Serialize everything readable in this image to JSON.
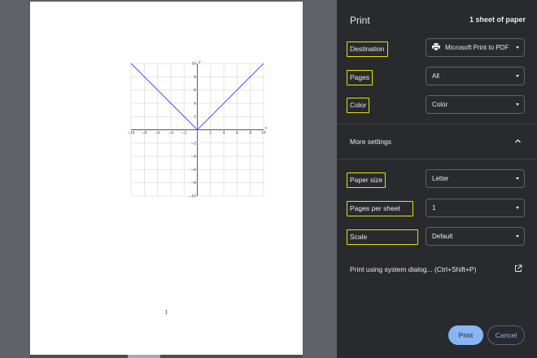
{
  "header": {
    "title": "Print",
    "sheet_count": "1 sheet of paper"
  },
  "settings": {
    "destination": {
      "label": "Destination",
      "value": "Microsoft Print to PDF",
      "icon": "printer-icon"
    },
    "pages": {
      "label": "Pages",
      "value": "All"
    },
    "color": {
      "label": "Color",
      "value": "Color"
    },
    "more_settings": "More settings",
    "paper_size": {
      "label": "Paper size",
      "value": "Letter"
    },
    "pages_per_sheet": {
      "label": "Pages per sheet",
      "value": "1"
    },
    "scale": {
      "label": "Scale",
      "value": "Default"
    }
  },
  "system_dialog": "Print using system dialog... (Ctrl+Shift+P)",
  "buttons": {
    "print": "Print",
    "cancel": "Cancel"
  },
  "highlight_color": "#e8e200",
  "preview": {
    "page_number": "1",
    "graph": {
      "x_ticks": [
        "−10",
        "−8",
        "−6",
        "−4",
        "−2",
        "2",
        "4",
        "6",
        "8",
        "10"
      ],
      "x_values": [
        -10,
        -8,
        -6,
        -4,
        -2,
        2,
        4,
        6,
        8,
        10
      ],
      "y_ticks": [
        "10",
        "8",
        "6",
        "4",
        "2",
        "−2",
        "−4",
        "−6",
        "−8",
        "−10"
      ],
      "y_values": [
        10,
        8,
        6,
        4,
        2,
        -2,
        -4,
        -6,
        -8,
        -10
      ],
      "x_axis_label": "x",
      "y_axis_label": "y",
      "xlim": [
        -10,
        10
      ],
      "ylim": [
        -10,
        10
      ],
      "line_points": [
        [
          -10,
          10
        ],
        [
          0,
          0
        ],
        [
          10,
          10
        ]
      ],
      "line_color": "#4c5ff5"
    }
  }
}
